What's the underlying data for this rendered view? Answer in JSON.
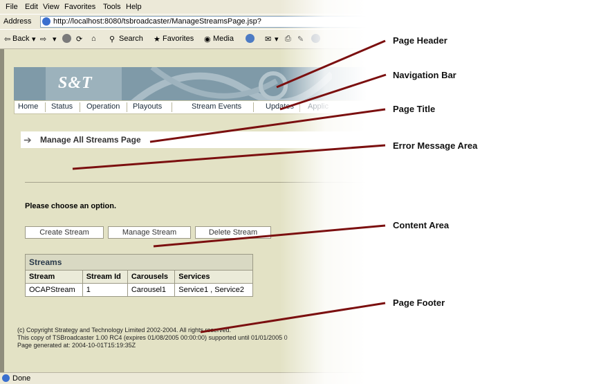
{
  "menu": [
    "File",
    "Edit",
    "View",
    "Favorites",
    "Tools",
    "Help"
  ],
  "address": {
    "label": "Address",
    "url": "http://localhost:8080/tsbroadcaster/ManageStreamsPage.jsp?"
  },
  "toolbar": {
    "back": "Back",
    "search": "Search",
    "favorites": "Favorites",
    "media": "Media"
  },
  "banner": {
    "logo": "S&T"
  },
  "nav": [
    "Home",
    "Status",
    "Operation",
    "Playouts",
    "Stream Events",
    "Updates",
    "Applic"
  ],
  "page_title": "Manage All Streams Page",
  "choose_label": "Please choose an option.",
  "buttons": {
    "create": "Create Stream",
    "manage": "Manage Stream",
    "delete": "Delete Stream"
  },
  "streams_table": {
    "caption": "Streams",
    "headers": [
      "Stream",
      "Stream Id",
      "Carousels",
      "Services"
    ],
    "rows": [
      [
        "OCAPStream",
        "1",
        "Carousel1",
        "Service1 , Service2"
      ]
    ]
  },
  "footer": {
    "line1": "(c) Copyright Strategy and Technology Limited 2002-2004. All rights reserved.",
    "line2": "This copy of TSBroadcaster 1.00 RC4 (expires 01/08/2005 00:00:00) supported until 01/01/2005 0",
    "line3": "Page generated at: 2004-10-01T15:19:35Z"
  },
  "status": "Done",
  "callouts": {
    "header": "Page Header",
    "nav": "Navigation Bar",
    "title": "Page Title",
    "error": "Error Message Area",
    "content": "Content Area",
    "footer": "Page Footer"
  },
  "colors": {
    "page_bg": "#e3e2c5",
    "banner": "#7f9aa8",
    "leader_lines": "#7b0f0f"
  }
}
